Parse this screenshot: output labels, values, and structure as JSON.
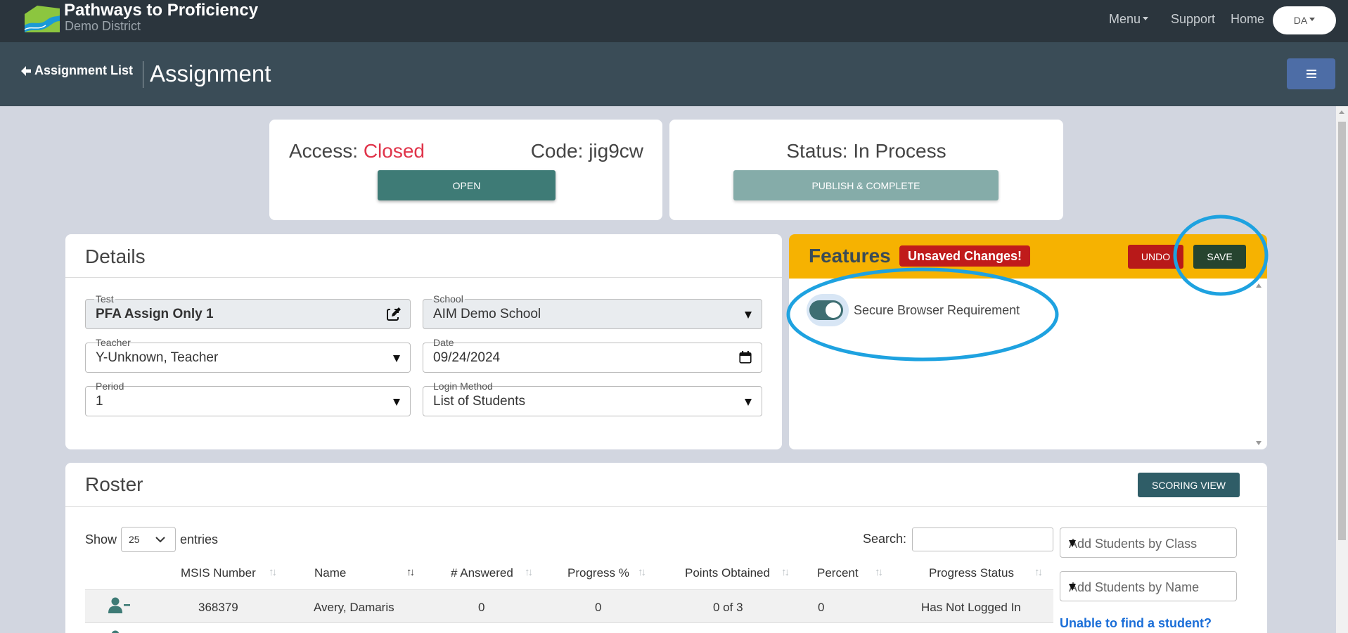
{
  "app": {
    "title": "Pathways to Proficiency",
    "subtitle": "Demo District",
    "nav": {
      "menu": "Menu",
      "support": "Support",
      "home": "Home",
      "user": "DA"
    }
  },
  "subheader": {
    "back": "Assignment List",
    "title": "Assignment"
  },
  "access_card": {
    "access_label": "Access:",
    "access_value": "Closed",
    "code_label": "Code:",
    "code_value": "jig9cw",
    "open_button": "OPEN"
  },
  "status_card": {
    "status_label": "Status:",
    "status_value": "In Process",
    "publish_button": "PUBLISH & COMPLETE"
  },
  "details": {
    "title": "Details",
    "test_label": "Test",
    "test_value": "PFA Assign Only 1",
    "school_label": "School",
    "school_value": "AIM Demo School",
    "teacher_label": "Teacher",
    "teacher_value": "Y-Unknown, Teacher",
    "date_label": "Date",
    "date_value": "09/24/2024",
    "period_label": "Period",
    "period_value": "1",
    "login_label": "Login Method",
    "login_value": "List of Students"
  },
  "features": {
    "title": "Features",
    "badge": "Unsaved Changes!",
    "undo": "UNDO",
    "save": "SAVE",
    "toggle_label": "Secure Browser Requirement",
    "toggle_on": true
  },
  "roster": {
    "title": "Roster",
    "scoring_button": "SCORING VIEW",
    "show_label": "Show",
    "entries_value": "25",
    "entries_label": "entries",
    "search_label": "Search:",
    "add_by_class": "Add Students by Class",
    "add_by_name": "Add Students by Name",
    "unable_link": "Unable to find a student?",
    "columns": [
      "MSIS Number",
      "Name",
      "# Answered",
      "Progress %",
      "Points Obtained",
      "Percent",
      "Progress Status"
    ],
    "rows": [
      {
        "msis": "368379",
        "name": "Avery, Damaris",
        "answered": "0",
        "progress": "0",
        "points": "0 of 3",
        "percent": "0",
        "status": "Has Not Logged In"
      }
    ]
  },
  "colors": {
    "topnav": "#2b353d",
    "subheader": "#3a4c57",
    "features_header": "#f6b201",
    "closed": "#e0344a",
    "highlight": "#1ea2e0"
  }
}
